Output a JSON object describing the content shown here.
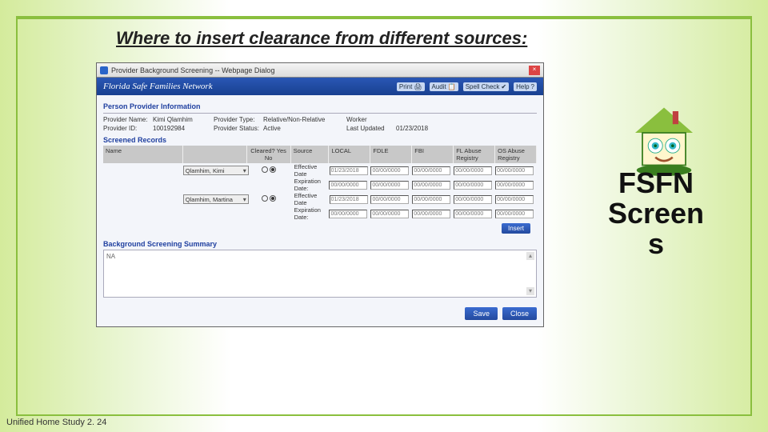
{
  "slide": {
    "title": "Where to insert clearance from different sources:",
    "footer": "Unified Home Study 2. 24",
    "sideTitle1": "FSFN",
    "sideTitle2": "Screen",
    "sideTitle3": "s"
  },
  "dialog": {
    "windowTitle": "Provider Background Screening -- Webpage Dialog",
    "appName": "Florida Safe Families Network",
    "toolbar": {
      "print": "Print",
      "audit": "Audit",
      "spell": "Spell Check",
      "help": "Help"
    },
    "sections": {
      "personInfo": "Person Provider Information",
      "screened": "Screened Records",
      "summary": "Background Screening Summary"
    },
    "info": {
      "providerNameLabel": "Provider Name:",
      "providerName": "Kimi Qlamhim",
      "providerIdLabel": "Provider ID:",
      "providerId": "100192984",
      "providerTypeLabel": "Provider Type:",
      "providerType": "Relative/Non-Relative",
      "providerStatusLabel": "Provider Status:",
      "providerStatus": "Active",
      "workerLabel": "Worker",
      "worker": "",
      "lastUpdatedLabel": "Last Updated",
      "lastUpdated": "01/23/2018"
    },
    "grid": {
      "col_name": "Name",
      "col_cleared": "Cleared? Yes No",
      "col_source": "Source",
      "col_local": "LOCAL",
      "col_fdle": "FDLE",
      "col_fbi": "FBI",
      "col_flabuse": "FL Abuse Registry",
      "col_osabuse": "OS Abuse Registry",
      "rows": [
        {
          "name": "Qlamhim, Kimi",
          "effLabel": "Effective Date",
          "expLabel": "Expiration Date:",
          "eff": [
            "01/23/2018",
            "00/00/0000",
            "00/00/0000",
            "00/00/0000",
            "00/00/0000"
          ],
          "exp": [
            "00/00/0000",
            "00/00/0000",
            "00/00/0000",
            "00/00/0000",
            "00/00/0000"
          ]
        },
        {
          "name": "Qlamhim, Martina",
          "effLabel": "Effective Date",
          "expLabel": "Expiration Date:",
          "eff": [
            "01/23/2018",
            "00/00/0000",
            "00/00/0000",
            "00/00/0000",
            "00/00/0000"
          ],
          "exp": [
            "00/00/0000",
            "00/00/0000",
            "00/00/0000",
            "00/00/0000",
            "00/00/0000"
          ]
        }
      ]
    },
    "summaryText": "NA",
    "buttons": {
      "insert": "Insert",
      "save": "Save",
      "close": "Close"
    }
  }
}
